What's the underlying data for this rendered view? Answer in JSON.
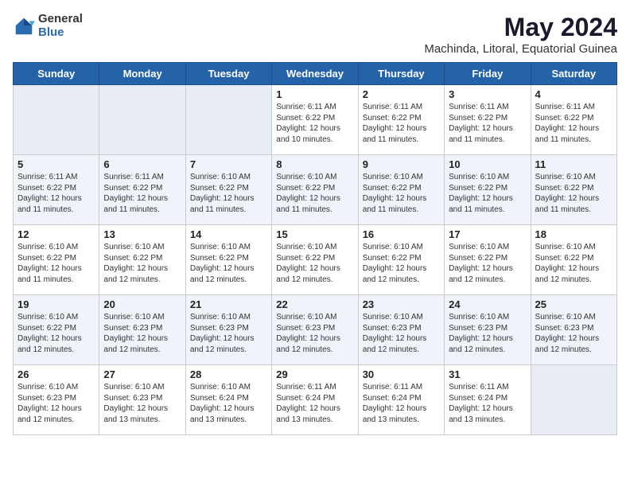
{
  "logo": {
    "general": "General",
    "blue": "Blue"
  },
  "title": "May 2024",
  "subtitle": "Machinda, Litoral, Equatorial Guinea",
  "headers": [
    "Sunday",
    "Monday",
    "Tuesday",
    "Wednesday",
    "Thursday",
    "Friday",
    "Saturday"
  ],
  "weeks": [
    [
      {
        "day": "",
        "info": ""
      },
      {
        "day": "",
        "info": ""
      },
      {
        "day": "",
        "info": ""
      },
      {
        "day": "1",
        "info": "Sunrise: 6:11 AM\nSunset: 6:22 PM\nDaylight: 12 hours\nand 10 minutes."
      },
      {
        "day": "2",
        "info": "Sunrise: 6:11 AM\nSunset: 6:22 PM\nDaylight: 12 hours\nand 11 minutes."
      },
      {
        "day": "3",
        "info": "Sunrise: 6:11 AM\nSunset: 6:22 PM\nDaylight: 12 hours\nand 11 minutes."
      },
      {
        "day": "4",
        "info": "Sunrise: 6:11 AM\nSunset: 6:22 PM\nDaylight: 12 hours\nand 11 minutes."
      }
    ],
    [
      {
        "day": "5",
        "info": "Sunrise: 6:11 AM\nSunset: 6:22 PM\nDaylight: 12 hours\nand 11 minutes."
      },
      {
        "day": "6",
        "info": "Sunrise: 6:11 AM\nSunset: 6:22 PM\nDaylight: 12 hours\nand 11 minutes."
      },
      {
        "day": "7",
        "info": "Sunrise: 6:10 AM\nSunset: 6:22 PM\nDaylight: 12 hours\nand 11 minutes."
      },
      {
        "day": "8",
        "info": "Sunrise: 6:10 AM\nSunset: 6:22 PM\nDaylight: 12 hours\nand 11 minutes."
      },
      {
        "day": "9",
        "info": "Sunrise: 6:10 AM\nSunset: 6:22 PM\nDaylight: 12 hours\nand 11 minutes."
      },
      {
        "day": "10",
        "info": "Sunrise: 6:10 AM\nSunset: 6:22 PM\nDaylight: 12 hours\nand 11 minutes."
      },
      {
        "day": "11",
        "info": "Sunrise: 6:10 AM\nSunset: 6:22 PM\nDaylight: 12 hours\nand 11 minutes."
      }
    ],
    [
      {
        "day": "12",
        "info": "Sunrise: 6:10 AM\nSunset: 6:22 PM\nDaylight: 12 hours\nand 11 minutes."
      },
      {
        "day": "13",
        "info": "Sunrise: 6:10 AM\nSunset: 6:22 PM\nDaylight: 12 hours\nand 12 minutes."
      },
      {
        "day": "14",
        "info": "Sunrise: 6:10 AM\nSunset: 6:22 PM\nDaylight: 12 hours\nand 12 minutes."
      },
      {
        "day": "15",
        "info": "Sunrise: 6:10 AM\nSunset: 6:22 PM\nDaylight: 12 hours\nand 12 minutes."
      },
      {
        "day": "16",
        "info": "Sunrise: 6:10 AM\nSunset: 6:22 PM\nDaylight: 12 hours\nand 12 minutes."
      },
      {
        "day": "17",
        "info": "Sunrise: 6:10 AM\nSunset: 6:22 PM\nDaylight: 12 hours\nand 12 minutes."
      },
      {
        "day": "18",
        "info": "Sunrise: 6:10 AM\nSunset: 6:22 PM\nDaylight: 12 hours\nand 12 minutes."
      }
    ],
    [
      {
        "day": "19",
        "info": "Sunrise: 6:10 AM\nSunset: 6:22 PM\nDaylight: 12 hours\nand 12 minutes."
      },
      {
        "day": "20",
        "info": "Sunrise: 6:10 AM\nSunset: 6:23 PM\nDaylight: 12 hours\nand 12 minutes."
      },
      {
        "day": "21",
        "info": "Sunrise: 6:10 AM\nSunset: 6:23 PM\nDaylight: 12 hours\nand 12 minutes."
      },
      {
        "day": "22",
        "info": "Sunrise: 6:10 AM\nSunset: 6:23 PM\nDaylight: 12 hours\nand 12 minutes."
      },
      {
        "day": "23",
        "info": "Sunrise: 6:10 AM\nSunset: 6:23 PM\nDaylight: 12 hours\nand 12 minutes."
      },
      {
        "day": "24",
        "info": "Sunrise: 6:10 AM\nSunset: 6:23 PM\nDaylight: 12 hours\nand 12 minutes."
      },
      {
        "day": "25",
        "info": "Sunrise: 6:10 AM\nSunset: 6:23 PM\nDaylight: 12 hours\nand 12 minutes."
      }
    ],
    [
      {
        "day": "26",
        "info": "Sunrise: 6:10 AM\nSunset: 6:23 PM\nDaylight: 12 hours\nand 12 minutes."
      },
      {
        "day": "27",
        "info": "Sunrise: 6:10 AM\nSunset: 6:23 PM\nDaylight: 12 hours\nand 13 minutes."
      },
      {
        "day": "28",
        "info": "Sunrise: 6:10 AM\nSunset: 6:24 PM\nDaylight: 12 hours\nand 13 minutes."
      },
      {
        "day": "29",
        "info": "Sunrise: 6:11 AM\nSunset: 6:24 PM\nDaylight: 12 hours\nand 13 minutes."
      },
      {
        "day": "30",
        "info": "Sunrise: 6:11 AM\nSunset: 6:24 PM\nDaylight: 12 hours\nand 13 minutes."
      },
      {
        "day": "31",
        "info": "Sunrise: 6:11 AM\nSunset: 6:24 PM\nDaylight: 12 hours\nand 13 minutes."
      },
      {
        "day": "",
        "info": ""
      }
    ]
  ]
}
